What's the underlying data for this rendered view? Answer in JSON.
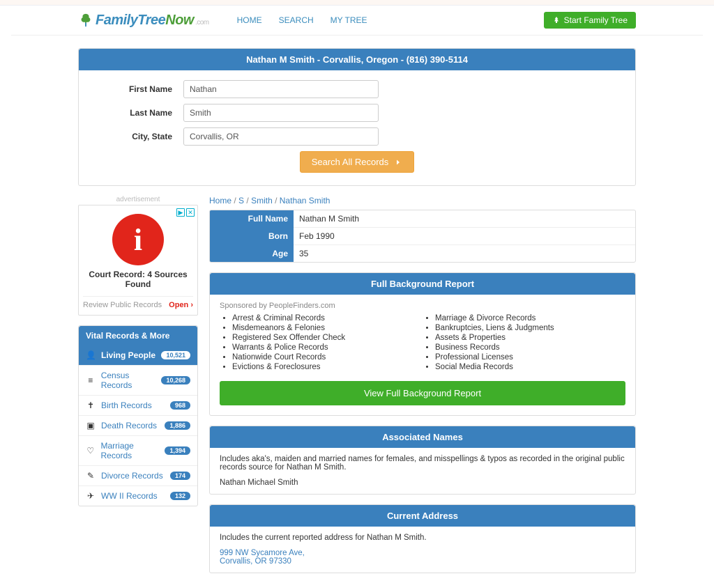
{
  "brand": {
    "family": "Family",
    "tree": "Tree",
    "now": "Now",
    "dotcom": ".com"
  },
  "nav": {
    "home": "HOME",
    "search": "SEARCH",
    "mytree": "MY TREE",
    "start_btn": "Start Family Tree"
  },
  "search_panel": {
    "title": "Nathan M Smith - Corvallis, Oregon - (816) 390-5114",
    "first_name_label": "First Name",
    "first_name_value": "Nathan",
    "last_name_label": "Last Name",
    "last_name_value": "Smith",
    "city_label": "City, State",
    "city_value": "Corvallis, OR",
    "button": "Search All Records"
  },
  "ad": {
    "label": "advertisement",
    "title": "Court Record: 4 Sources Found",
    "review": "Review Public Records",
    "open": "Open"
  },
  "sidebar": {
    "title": "Vital Records & More",
    "items": [
      {
        "icon": "👤",
        "label": "Living People",
        "count": "10,521",
        "active": true
      },
      {
        "icon": "≡",
        "label": "Census Records",
        "count": "10,268",
        "active": false
      },
      {
        "icon": "✝",
        "label": "Birth Records",
        "count": "968",
        "active": false
      },
      {
        "icon": "▣",
        "label": "Death Records",
        "count": "1,886",
        "active": false
      },
      {
        "icon": "♡",
        "label": "Marriage Records",
        "count": "1,394",
        "active": false
      },
      {
        "icon": "✎",
        "label": "Divorce Records",
        "count": "174",
        "active": false
      },
      {
        "icon": "✈",
        "label": "WW II Records",
        "count": "132",
        "active": false
      }
    ]
  },
  "breadcrumb": {
    "home": "Home",
    "sep": " / ",
    "s": "S",
    "smith": "Smith",
    "person": "Nathan Smith"
  },
  "info": {
    "fullname_k": "Full Name",
    "fullname_v": "Nathan M Smith",
    "born_k": "Born",
    "born_v": "Feb 1990",
    "age_k": "Age",
    "age_v": "35"
  },
  "report": {
    "title": "Full Background Report",
    "sponsored": "Sponsored by PeopleFinders.com",
    "left": [
      "Arrest & Criminal Records",
      "Misdemeanors & Felonies",
      "Registered Sex Offender Check",
      "Warrants & Police Records",
      "Nationwide Court Records",
      "Evictions & Foreclosures"
    ],
    "right": [
      "Marriage & Divorce Records",
      "Bankruptcies, Liens & Judgments",
      "Assets & Properties",
      "Business Records",
      "Professional Licenses",
      "Social Media Records"
    ],
    "button": "View Full Background Report"
  },
  "assoc": {
    "title": "Associated Names",
    "note": "Includes aka's, maiden and married names for females, and misspellings & typos as recorded in the original public records source for Nathan M Smith.",
    "name": "Nathan Michael Smith"
  },
  "addr": {
    "title": "Current Address",
    "note": "Includes the current reported address for Nathan M Smith.",
    "line1": "999 NW Sycamore Ave,",
    "line2": "Corvallis, OR 97330"
  }
}
